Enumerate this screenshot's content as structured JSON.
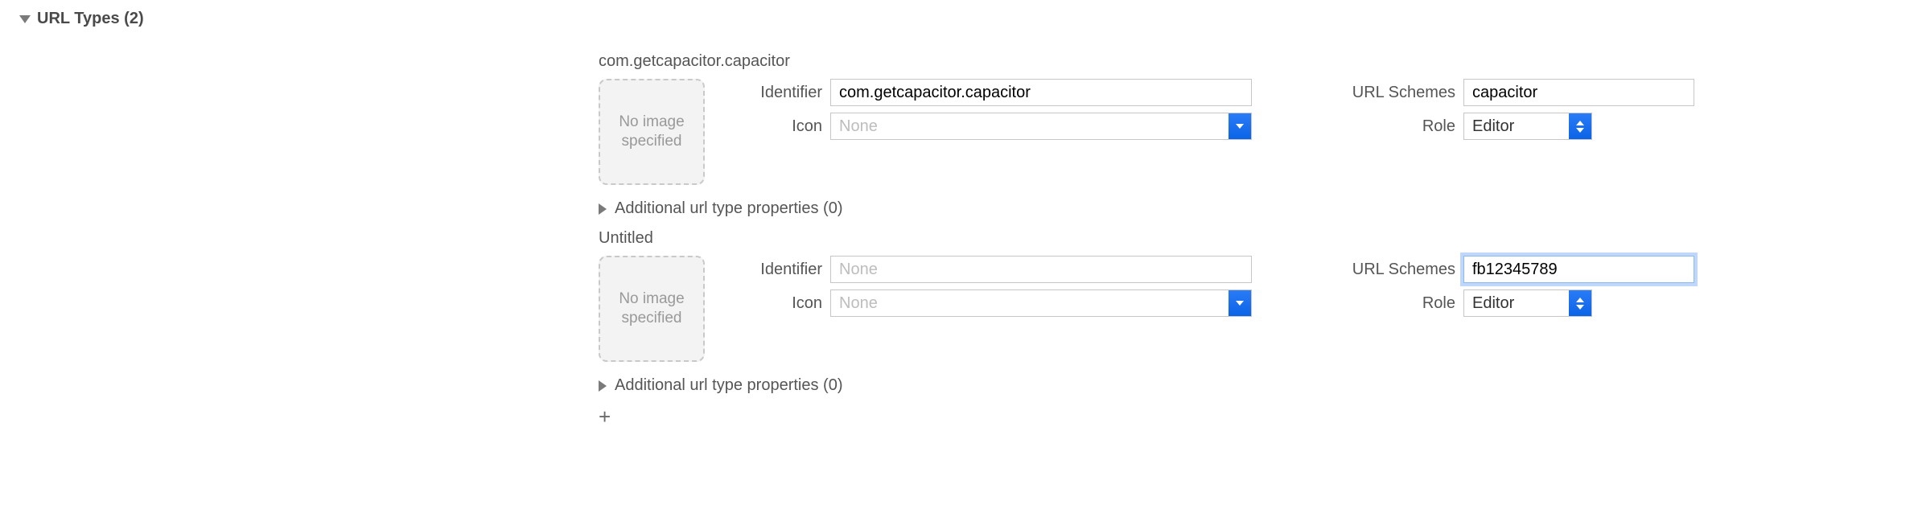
{
  "section": {
    "title": "URL Types (2)"
  },
  "labels": {
    "identifier": "Identifier",
    "icon": "Icon",
    "url_schemes": "URL Schemes",
    "role": "Role",
    "none_placeholder": "None",
    "no_image": "No image specified"
  },
  "entries": [
    {
      "title": "com.getcapacitor.capacitor",
      "identifier": "com.getcapacitor.capacitor",
      "icon": "",
      "url_schemes": "capacitor",
      "role": "Editor",
      "additional": "Additional url type properties (0)",
      "schemes_focused": false
    },
    {
      "title": "Untitled",
      "identifier": "",
      "icon": "",
      "url_schemes": "fb12345789",
      "role": "Editor",
      "additional": "Additional url type properties (0)",
      "schemes_focused": true
    }
  ],
  "footer": {
    "add": "+"
  }
}
